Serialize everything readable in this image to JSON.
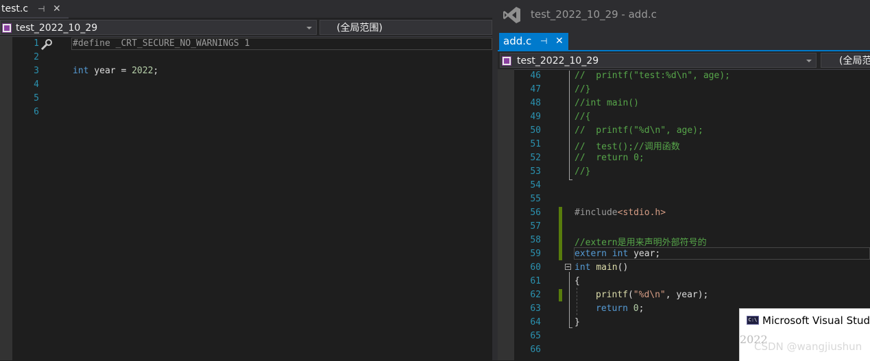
{
  "left_editor": {
    "tab_label": "test.c",
    "project": "test_2022_10_29",
    "scope": "(全局范围)",
    "line_numbers": [
      "1",
      "2",
      "3",
      "4",
      "5",
      "6"
    ],
    "lines": {
      "l1_directive": "#define",
      "l1_macro": " _CRT_SECURE_NO_WARNINGS 1",
      "l3_type": "int",
      "l3_rest": " year = ",
      "l3_num": "2022",
      "l3_semi": ";"
    }
  },
  "right_editor": {
    "window_title": "test_2022_10_29 - add.c",
    "tab_label": "add.c",
    "project": "test_2022_10_29",
    "scope": "(全局范",
    "line_numbers": [
      "46",
      "47",
      "48",
      "49",
      "50",
      "51",
      "52",
      "53",
      "54",
      "55",
      "56",
      "57",
      "58",
      "59",
      "60",
      "61",
      "62",
      "63",
      "64",
      "65",
      "66"
    ],
    "lines": {
      "l46": "//  printf(\"test:%d\\n\", age);",
      "l47": "//}",
      "l48": "//int main()",
      "l49": "//{",
      "l50": "//  printf(\"%d\\n\", age);",
      "l51": "//  test();//调用函数",
      "l52": "//  return 0;",
      "l53": "//}",
      "l56_directive": "#include",
      "l56_header": "<stdio.h>",
      "l58": "//extern是用来声明外部符号的",
      "l59_kw1": "extern",
      "l59_kw2": "int",
      "l59_rest": " year;",
      "l60_type": "int",
      "l60_fn": "main",
      "l60_rest": "()",
      "l61": "{",
      "l62_fn": "printf",
      "l62_open": "(",
      "l62_str": "\"%d\\n\"",
      "l62_rest": ", year);",
      "l63_kw": "return",
      "l63_num": "0",
      "l63_semi": ";",
      "l64": "}"
    }
  },
  "console_popup": {
    "title": "Microsoft Visual Stud",
    "icon_text": "C:\\",
    "output": "2022"
  },
  "watermark": "CSDN @wangjiushun",
  "colors": {
    "keyword": "#569cd6",
    "comment": "#57a64a",
    "string": "#d69d85",
    "number": "#b5cea8",
    "line_number": "#2b91af",
    "accent": "#007acc",
    "change_bar": "#587c0c"
  },
  "icons": [
    "pin-icon",
    "close-icon",
    "project-icon",
    "dropdown-caret-icon",
    "vs-logo-icon",
    "console-icon",
    "wrench-icon",
    "collapse-icon"
  ]
}
